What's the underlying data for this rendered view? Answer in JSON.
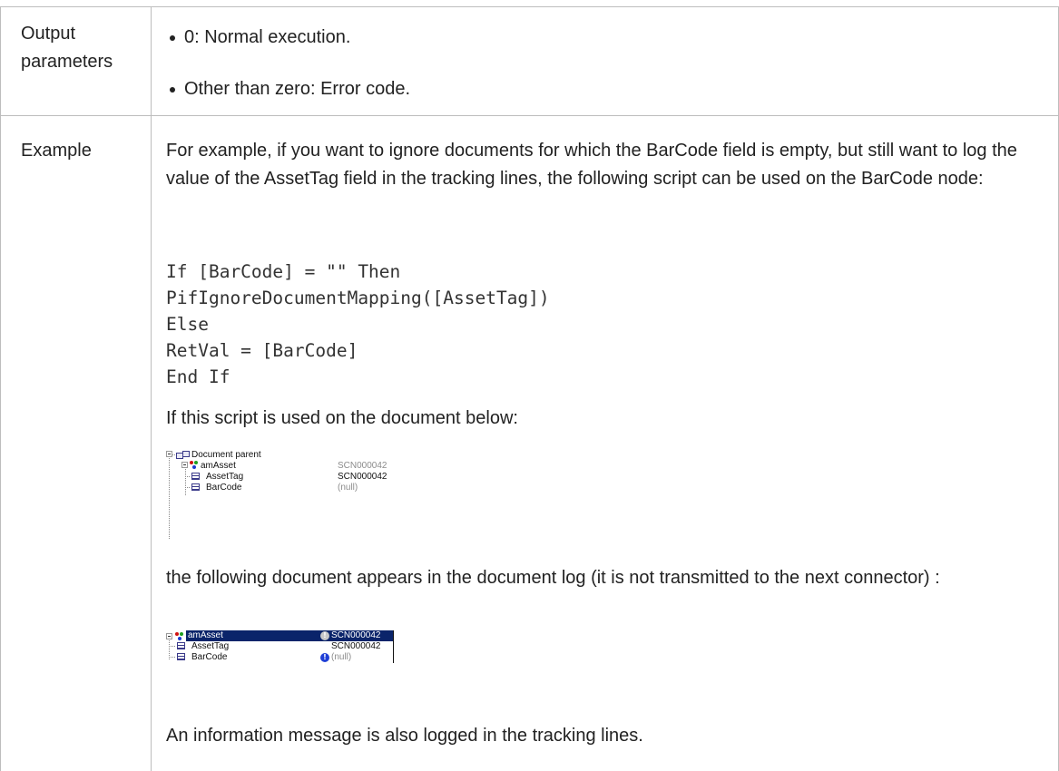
{
  "rows": {
    "output": {
      "label_line1": "Output",
      "label_line2": "parameters",
      "items": [
        "0: Normal execution.",
        "Other than zero: Error code."
      ]
    },
    "example": {
      "label": "Example",
      "intro": "For example, if you want to ignore documents for which the BarCode field is empty, but still want to log the value of the AssetTag field in the tracking lines, the following script can be used on the BarCode node:",
      "code": [
        "If [BarCode] = \"\" Then",
        "PifIgnoreDocumentMapping([AssetTag])",
        "Else",
        "RetVal = [BarCode]",
        "End If"
      ],
      "used_text": "If this script is used on the document below:",
      "tree1": {
        "root": "Document parent",
        "entity": "amAsset",
        "entity_value": "SCN000042",
        "fields": [
          {
            "name": "AssetTag",
            "value": "SCN000042"
          },
          {
            "name": "BarCode",
            "value": "(null)"
          }
        ]
      },
      "following_text": "the following document appears in the document log (it is not transmitted to the next connector) :",
      "tree2": {
        "entity": "amAsset",
        "entity_value": "SCN000042",
        "fields": [
          {
            "name": "AssetTag",
            "value": "SCN000042"
          },
          {
            "name": "BarCode",
            "value": "(null)"
          }
        ]
      },
      "info_text": "An information message is also logged in the tracking lines."
    }
  },
  "colors": {
    "selection": "#0a246a",
    "info_icon_blue": "#1f3fd6",
    "grey_value": "#8c8c8c",
    "border": "#bdbdbd"
  }
}
